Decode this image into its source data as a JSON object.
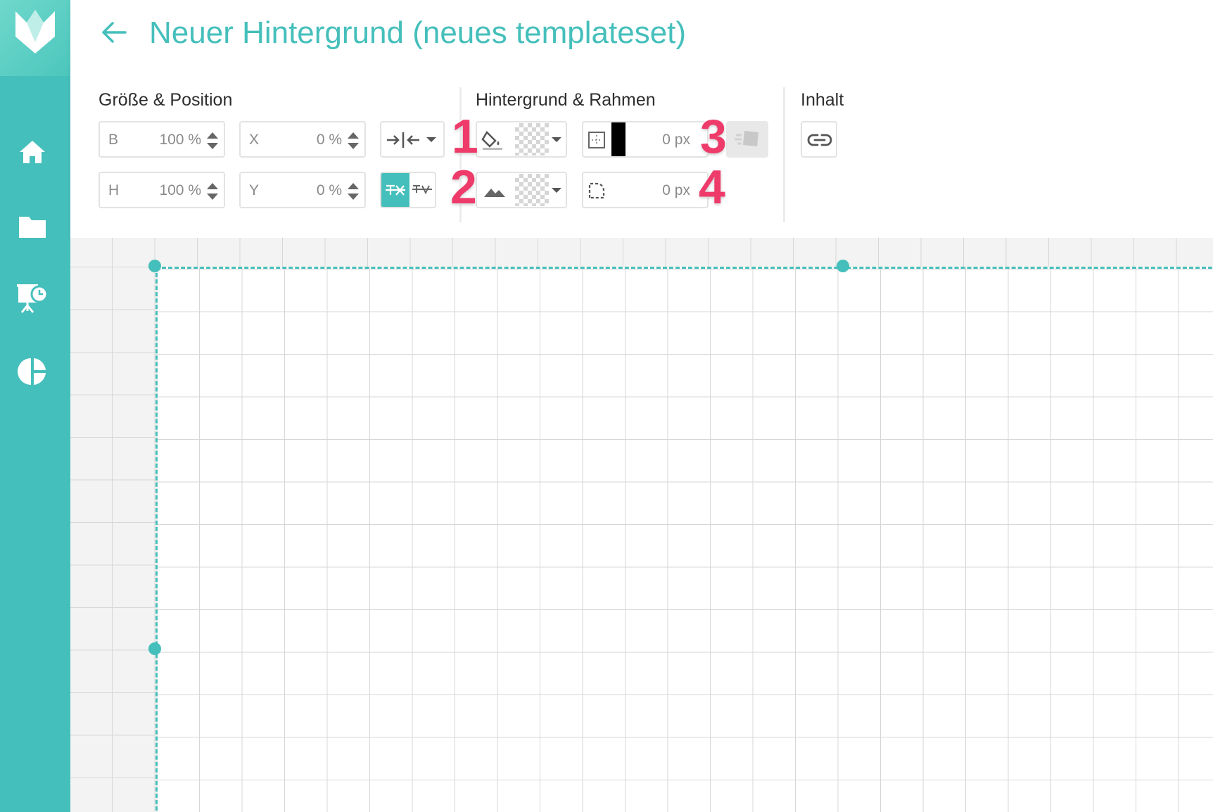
{
  "header": {
    "title": "Neuer Hintergrund (neues templateset)"
  },
  "sidebar": {
    "items": [
      {
        "icon": "home-icon"
      },
      {
        "icon": "folder-icon"
      },
      {
        "icon": "presentation-clock-icon"
      },
      {
        "icon": "pie-chart-icon"
      }
    ]
  },
  "sections": {
    "size_position": "Größe & Position",
    "background_border": "Hintergrund & Rahmen",
    "content": "Inhalt"
  },
  "fields": {
    "width": {
      "label": "B",
      "value": "100 %"
    },
    "height": {
      "label": "H",
      "value": "100 %"
    },
    "x": {
      "label": "X",
      "value": "0 %"
    },
    "y": {
      "label": "Y",
      "value": "0 %"
    },
    "border_width": {
      "value": "0 px"
    },
    "border_radius": {
      "value": "0 px"
    }
  },
  "markers": [
    "1",
    "2",
    "3",
    "4"
  ],
  "colors": {
    "accent": "#45bfbb",
    "marker": "#ee3b6a",
    "border_color": "#000000"
  }
}
